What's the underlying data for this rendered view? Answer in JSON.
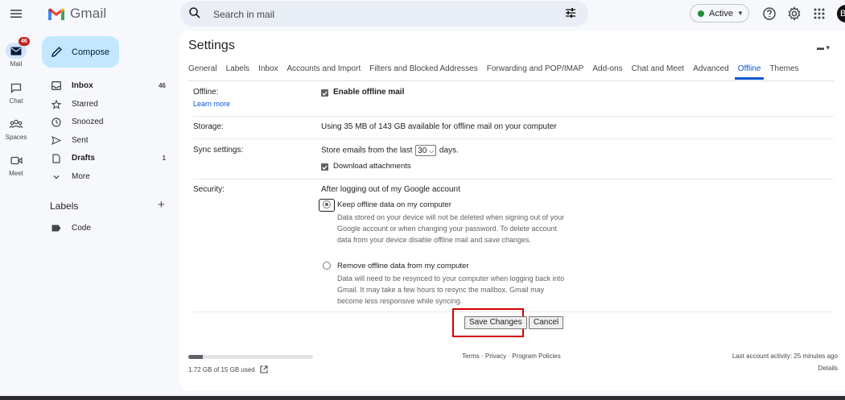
{
  "app": {
    "name": "Gmail"
  },
  "search": {
    "placeholder": "Search in mail"
  },
  "status": {
    "label": "Active",
    "color": "#1e8e3e"
  },
  "avatar": {
    "initial": "B"
  },
  "rail": [
    {
      "label": "Mail",
      "badge": "46"
    },
    {
      "label": "Chat"
    },
    {
      "label": "Spaces"
    },
    {
      "label": "Meet"
    }
  ],
  "compose": {
    "label": "Compose"
  },
  "nav": [
    {
      "label": "Inbox",
      "count": "46"
    },
    {
      "label": "Starred",
      "count": ""
    },
    {
      "label": "Snoozed",
      "count": ""
    },
    {
      "label": "Sent",
      "count": ""
    },
    {
      "label": "Drafts",
      "count": "1"
    },
    {
      "label": "More",
      "count": ""
    }
  ],
  "labels": {
    "title": "Labels",
    "items": [
      "Code"
    ]
  },
  "settings": {
    "title": "Settings",
    "tabs": [
      "General",
      "Labels",
      "Inbox",
      "Accounts and Import",
      "Filters and Blocked Addresses",
      "Forwarding and POP/IMAP",
      "Add-ons",
      "Chat and Meet",
      "Advanced",
      "Offline",
      "Themes"
    ],
    "active_tab": "Offline",
    "offline": {
      "label": "Offline:",
      "learn_more": "Learn more",
      "enable_label": "Enable offline mail"
    },
    "storage": {
      "label": "Storage:",
      "text": "Using 35 MB of 143 GB available for offline mail on your computer"
    },
    "sync": {
      "label": "Sync settings:",
      "prefix": "Store emails from the last",
      "days_value": "30",
      "suffix": "days.",
      "attachments_label": "Download attachments"
    },
    "security": {
      "label": "Security:",
      "heading": "After logging out of my Google account",
      "keep_label": "Keep offline data on my computer",
      "keep_desc": "Data stored on your device will not be deleted when signing out of your Google account or when changing your password. To delete account data from your device disable offline mail and save changes.",
      "remove_label": "Remove offline data from my computer",
      "remove_desc": "Data will need to be resynced to your computer when logging back into Gmail. It may take a few hours to resync the mailbox. Gmail may become less responsive while syncing."
    },
    "buttons": {
      "save": "Save Changes",
      "cancel": "Cancel"
    }
  },
  "footer": {
    "storage_used": "1.72 GB of 15 GB used",
    "storage_fraction": 0.115,
    "links": "Terms · Privacy · Program Policies",
    "last_activity": "Last account activity: 25 minutes ago",
    "details": "Details"
  }
}
